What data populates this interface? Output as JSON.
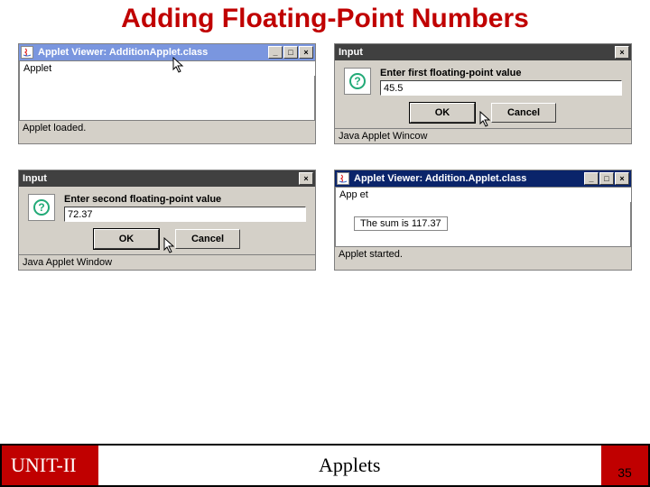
{
  "title": "Adding Floating-Point Numbers",
  "windows": {
    "appletViewer1": {
      "title": "Applet Viewer: AdditionApplet.class",
      "label": "Applet",
      "status": "Applet loaded."
    },
    "inputDialog1": {
      "title": "Input",
      "prompt": "Enter first floating-point value",
      "value": "45.5",
      "ok": "OK",
      "cancel": "Cancel",
      "status": "Java Applet Wincow"
    },
    "inputDialog2": {
      "title": "Input",
      "prompt": "Enter second floating-point value",
      "value": "72.37",
      "ok": "OK",
      "cancel": "Cancel",
      "status": "Java Applet Window"
    },
    "appletViewer2": {
      "title": "Applet Viewer: Addition.Applet.class",
      "label": "App et",
      "body": "The sum is 117.37",
      "status": "Applet started."
    }
  },
  "winControls": {
    "min": "_",
    "max": "□",
    "close": "×"
  },
  "footer": {
    "unit": "UNIT-II",
    "topic": "Applets",
    "page": "35"
  }
}
